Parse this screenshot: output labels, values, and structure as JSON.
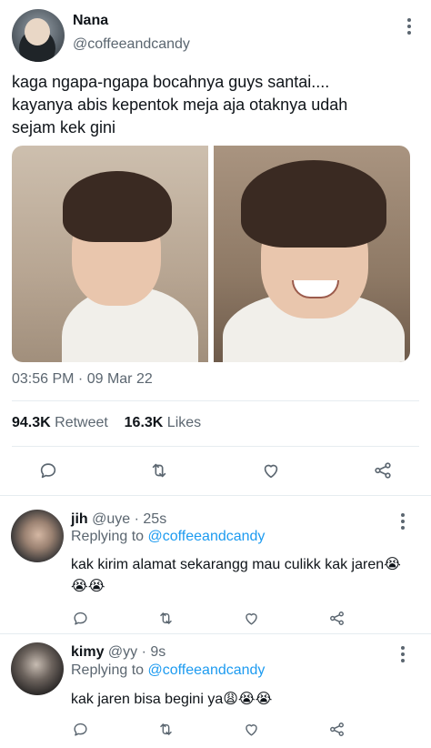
{
  "tweet": {
    "author_name": "Nana",
    "author_handle": "@coffeeandcandy",
    "text_lines": [
      "kaga ngapa-ngapa bocahnya guys santai....",
      "kayanya abis kepentok meja aja otaknya udah",
      "sejam kek gini"
    ],
    "timestamp": "03:56 PM · 09 Mar 22",
    "retweets_count": "94.3K",
    "retweets_label": "Retweet",
    "likes_count": "16.3K",
    "likes_label": "Likes"
  },
  "replies": [
    {
      "name": "jih",
      "handle": "@uye",
      "time": "· 25s",
      "replying_prefix": "Replying to",
      "replying_handle": "@coffeeandcandy",
      "text_line1": "kak kirim alamat sekarangg mau culikk kak jaren😭",
      "text_line2": "😭😭"
    },
    {
      "name": "kimy",
      "handle": "@yy",
      "time": "· 9s",
      "replying_prefix": "Replying to",
      "replying_handle": "@coffeeandcandy",
      "text_line1": "kak jaren bisa begini ya😩😭😭"
    }
  ],
  "icons": {
    "reply": "reply-icon",
    "retweet": "retweet-icon",
    "like": "heart-icon",
    "share": "share-icon",
    "more": "more-icon"
  },
  "colors": {
    "text": "#0f1419",
    "muted": "#5b6670",
    "link": "#1d9bf0",
    "divider": "#e6ecf0"
  }
}
